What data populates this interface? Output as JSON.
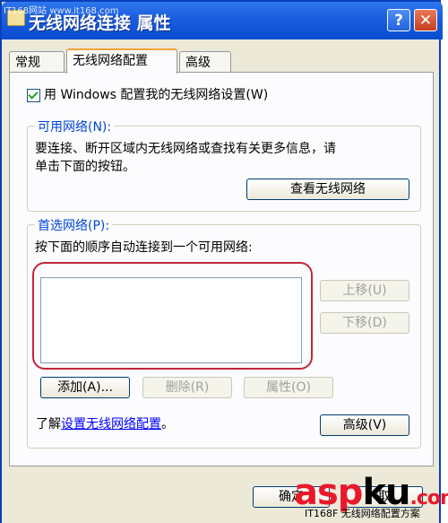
{
  "window": {
    "title": "无线网络连接 属性",
    "watermark_text": "IT168网站 www.it168.com",
    "help_label": "?",
    "close_label": "✕"
  },
  "tabs": [
    {
      "label": "常规"
    },
    {
      "label": "无线网络配置",
      "active": true
    },
    {
      "label": "高级"
    }
  ],
  "wireless_config": {
    "use_windows_label": "用 Windows 配置我的无线网络设置(W)",
    "use_windows_checked": true,
    "available_networks": {
      "title": "可用网络(N):",
      "description_line1": "要连接、断开区域内无线网络或查找有关更多信息，请",
      "description_line2": "单击下面的按钮。",
      "view_button": "查看无线网络"
    },
    "preferred_networks": {
      "title": "首选网络(P):",
      "description": "按下面的顺序自动连接到一个可用网络:",
      "list_items": [],
      "move_up_button": "上移(U)",
      "move_down_button": "下移(D)",
      "add_button": "添加(A)...",
      "remove_button": "删除(R)",
      "properties_button": "属性(O)"
    },
    "learn_prefix": "了解",
    "learn_link": "设置无线网络配置",
    "learn_suffix": "。",
    "advanced_button": "高级(V)"
  },
  "footer": {
    "ok_button": "确定",
    "cancel_fragment": "取",
    "logo_red1": "asp",
    "logo_black": "ku",
    "logo_red2": ".com",
    "bottom_watermark": "IT168F 无线网络配置方案"
  },
  "colors": {
    "titlebar": "#0a4cd1",
    "group_title": "#0046d5",
    "highlight": "#c0283a",
    "tab_accent": "#f0a23a"
  }
}
